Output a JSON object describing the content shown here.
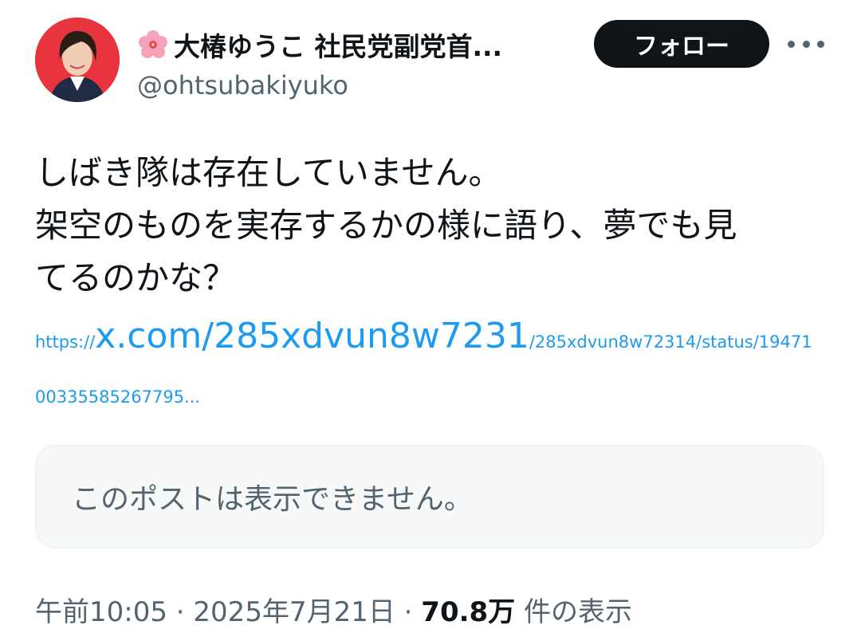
{
  "author": {
    "name": "大椿ゆうこ 社民党副党首...",
    "handle": "@ohtsubakiyuko",
    "avatar_icon": "profile-photo-icon",
    "name_emoji_icon": "hibiscus-icon"
  },
  "actions": {
    "follow_label": "フォロー",
    "more_icon": "more-horizontal-icon"
  },
  "tweet": {
    "lines": [
      "しばき隊は存在していません。",
      "架空のものを実存するかの様に語り、夢でも見",
      "てるのかな？"
    ],
    "link": {
      "prefix": "https://",
      "main": "x.com/285xdvun8w7231",
      "rest": "/285xdvun8w72314/status/19471",
      "line2": "00335585267795..."
    }
  },
  "quote": {
    "text": "このポストは表示できません。"
  },
  "meta": {
    "time": "午前10:05",
    "separator": " · ",
    "date": "2025年7月21日",
    "views_count": "70.8万",
    "views_label": " 件の表示"
  },
  "colors": {
    "link": "#1d9bf0",
    "avatar_bg": "#e8343e",
    "follow_bg": "#0f1419",
    "secondary_text": "#536471"
  }
}
